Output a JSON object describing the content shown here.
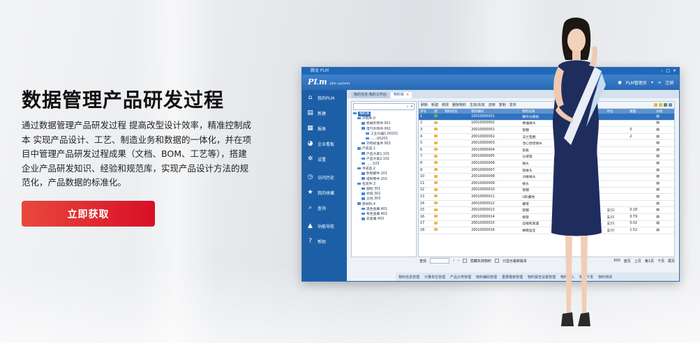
{
  "hero": {
    "title": "数据管理产品研发过程",
    "description": "通过数据管理产品研发过程 提高改型设计效率，精准控制成本 实现产品设计、工艺、制造业务和数据的一体化，并在项目中管理产品研发过程成果（文档、BOM、工艺等），搭建企业产品研发知识、经验和规范库，实现产品设计方法的规范化，产品数据的标准化。",
    "cta_label": "立即获取"
  },
  "app": {
    "window_title": "腾龙 PLM",
    "logo_text": "PLm",
    "logo_sub": "plm system",
    "user_label": "PLM管理员",
    "logout_label": "注销",
    "sidebar": [
      {
        "icon": "home-icon",
        "label": "我的PLM"
      },
      {
        "icon": "new-doc-icon",
        "label": "新建"
      },
      {
        "icon": "report-icon",
        "label": "报表"
      },
      {
        "icon": "enterprise-icon",
        "label": "企业看板"
      },
      {
        "icon": "settings-icon",
        "label": "设置"
      },
      {
        "icon": "history-icon",
        "label": "访问历史"
      },
      {
        "icon": "star-icon",
        "label": "我的收藏"
      },
      {
        "icon": "search-icon",
        "label": "查询"
      },
      {
        "icon": "nav-icon",
        "label": "功能导航"
      },
      {
        "icon": "help-icon",
        "label": "帮助"
      }
    ],
    "tabs": [
      {
        "label": "我的任务-我的工作台"
      },
      {
        "label": "物料库"
      }
    ],
    "tree": [
      {
        "label": "物料库",
        "level": 0,
        "selected": true
      },
      {
        "label": "外购件.0",
        "level": 1
      },
      {
        "label": "机械外购件.001",
        "level": 2
      },
      {
        "label": "电气外购件.002",
        "level": 2
      },
      {
        "label": "工业仪器1.00202",
        "level": 3
      },
      {
        "label": "......00203",
        "level": 3
      },
      {
        "label": "外购标准件.003",
        "level": 2
      },
      {
        "label": "产成品.1",
        "level": 1
      },
      {
        "label": "产品大类1.101",
        "level": 2
      },
      {
        "label": "产品大类2.102",
        "level": 2
      },
      {
        "label": "......103",
        "level": 2
      },
      {
        "label": "半成品.2",
        "level": 1
      },
      {
        "label": "卧制部件.201",
        "level": 2
      },
      {
        "label": "搭制零件.202",
        "level": 2
      },
      {
        "label": "包装件.3",
        "level": 1
      },
      {
        "label": "圆柱.301",
        "level": 2
      },
      {
        "label": "衬纸.302",
        "level": 2
      },
      {
        "label": "立柱.303",
        "level": 2
      },
      {
        "label": "原材料.4",
        "level": 1
      },
      {
        "label": "黑色金属.401",
        "level": 2
      },
      {
        "label": "有色金属.402",
        "level": 2
      },
      {
        "label": "非金属.403",
        "level": 2
      }
    ],
    "toolbar": [
      "刷新",
      "新建",
      "修改",
      "删除物料",
      "生效/失效",
      "流转",
      "复制",
      "发布"
    ],
    "columns": [
      "序号",
      "图",
      "物料状态",
      "物料编码",
      "物料名称",
      "规格型号",
      "单位",
      "数量",
      "价格"
    ],
    "rows": [
      {
        "n": "1",
        "code": "10010000001",
        "name": "硬件分模板",
        "spec": "",
        "unit": "",
        "qty": "",
        "sel": true
      },
      {
        "n": "2",
        "code": "10010000002",
        "name": "承插接头",
        "spec": "",
        "unit": "",
        "qty": ""
      },
      {
        "n": "3",
        "code": "20010000001",
        "name": "管帽",
        "spec": "",
        "unit": "",
        "qty": "0"
      },
      {
        "n": "4",
        "code": "20010000002",
        "name": "法兰垫圈",
        "spec": "",
        "unit": "",
        "qty": "2"
      },
      {
        "n": "5",
        "code": "20010000003",
        "name": "活心异径接头",
        "spec": "",
        "unit": "",
        "qty": ""
      },
      {
        "n": "6",
        "code": "20010000004",
        "name": "盲板",
        "spec": "",
        "unit": "",
        "qty": ""
      },
      {
        "n": "7",
        "code": "20010000005",
        "name": "分液管",
        "spec": "",
        "unit": "",
        "qty": ""
      },
      {
        "n": "8",
        "code": "20010000006",
        "name": "接头",
        "spec": "",
        "unit": "",
        "qty": ""
      },
      {
        "n": "9",
        "code": "20010000007",
        "name": "管接头",
        "spec": "",
        "unit": "",
        "qty": ""
      },
      {
        "n": "10",
        "code": "20010000008",
        "name": "对接接头",
        "spec": "",
        "unit": "",
        "qty": ""
      },
      {
        "n": "11",
        "code": "20010000009",
        "name": "接头",
        "spec": "",
        "unit": "",
        "qty": ""
      },
      {
        "n": "12",
        "code": "20010000010",
        "name": "管帽",
        "spec": "",
        "unit": "",
        "qty": ""
      },
      {
        "n": "13",
        "code": "20010000011",
        "name": "U形螺栓",
        "spec": "",
        "unit": "",
        "qty": ""
      },
      {
        "n": "14",
        "code": "20010000012",
        "name": "螺母",
        "spec": "",
        "unit": "",
        "qty": ""
      },
      {
        "n": "15",
        "code": "20010000013",
        "name": "管帽",
        "spec": "",
        "unit": "支/只",
        "qty": "0.18"
      },
      {
        "n": "16",
        "code": "20010000014",
        "name": "接管",
        "spec": "",
        "unit": "支/只",
        "qty": "0.79"
      },
      {
        "n": "17",
        "code": "20010000015",
        "name": "压缩机底座",
        "spec": "",
        "unit": "支/只",
        "qty": "0.02"
      },
      {
        "n": "18",
        "code": "20010000016",
        "name": "铸铁型支",
        "spec": "",
        "unit": "支/只",
        "qty": "1.52"
      }
    ],
    "pager": {
      "search_label": "查找",
      "hide_label": "隐藏失效物料",
      "only_label": "只显示最新版本",
      "page_size": "500",
      "items": [
        "首页",
        "上页",
        "第1页",
        "下页",
        "尾页"
      ]
    },
    "bottom_tabs": [
      "物料信息管理",
      "计量单位管理",
      "产品分类管理",
      "物料编码管理",
      "重要模板管理",
      "物料属性设置管理",
      "物料导入",
      "物料下发",
      "物料修改"
    ]
  }
}
